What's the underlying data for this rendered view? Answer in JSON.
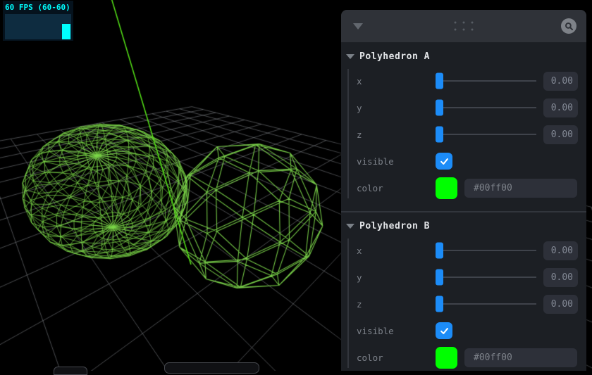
{
  "fps_meter": {
    "label": "60 FPS (60-60)",
    "fg_color": "#00ffff",
    "bg_color": "#0e2c40"
  },
  "scene": {
    "objects": [
      "wireframe-sphere",
      "wireframe-icosahedron",
      "grid-floor",
      "ray-line"
    ],
    "wireframe_color": "#00ff00",
    "grid_color": "#55565c",
    "background": "#000000"
  },
  "panel": {
    "accent_color": "#1c8cf8",
    "folders": [
      {
        "title": "Polyhedron A",
        "sliders": [
          {
            "label": "x",
            "value": "0.00"
          },
          {
            "label": "y",
            "value": "0.00"
          },
          {
            "label": "z",
            "value": "0.00"
          }
        ],
        "visible_label": "visible",
        "visible_checked": true,
        "color_label": "color",
        "color_value": "#00ff00"
      },
      {
        "title": "Polyhedron B",
        "sliders": [
          {
            "label": "x",
            "value": "0.00"
          },
          {
            "label": "y",
            "value": "0.00"
          },
          {
            "label": "z",
            "value": "0.00"
          }
        ],
        "visible_label": "visible",
        "visible_checked": true,
        "color_label": "color",
        "color_value": "#00ff00"
      }
    ]
  }
}
